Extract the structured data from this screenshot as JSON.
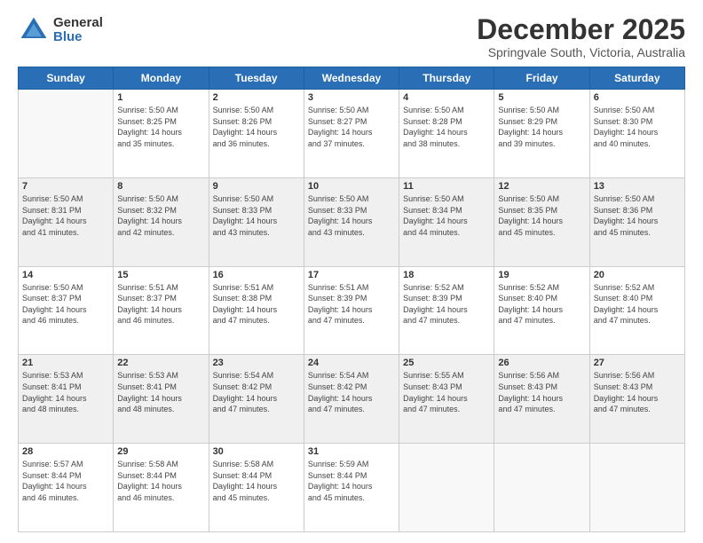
{
  "logo": {
    "general": "General",
    "blue": "Blue"
  },
  "header": {
    "month": "December 2025",
    "location": "Springvale South, Victoria, Australia"
  },
  "days_of_week": [
    "Sunday",
    "Monday",
    "Tuesday",
    "Wednesday",
    "Thursday",
    "Friday",
    "Saturday"
  ],
  "weeks": [
    [
      {
        "day": "",
        "info": ""
      },
      {
        "day": "1",
        "info": "Sunrise: 5:50 AM\nSunset: 8:25 PM\nDaylight: 14 hours\nand 35 minutes."
      },
      {
        "day": "2",
        "info": "Sunrise: 5:50 AM\nSunset: 8:26 PM\nDaylight: 14 hours\nand 36 minutes."
      },
      {
        "day": "3",
        "info": "Sunrise: 5:50 AM\nSunset: 8:27 PM\nDaylight: 14 hours\nand 37 minutes."
      },
      {
        "day": "4",
        "info": "Sunrise: 5:50 AM\nSunset: 8:28 PM\nDaylight: 14 hours\nand 38 minutes."
      },
      {
        "day": "5",
        "info": "Sunrise: 5:50 AM\nSunset: 8:29 PM\nDaylight: 14 hours\nand 39 minutes."
      },
      {
        "day": "6",
        "info": "Sunrise: 5:50 AM\nSunset: 8:30 PM\nDaylight: 14 hours\nand 40 minutes."
      }
    ],
    [
      {
        "day": "7",
        "info": "Sunrise: 5:50 AM\nSunset: 8:31 PM\nDaylight: 14 hours\nand 41 minutes."
      },
      {
        "day": "8",
        "info": "Sunrise: 5:50 AM\nSunset: 8:32 PM\nDaylight: 14 hours\nand 42 minutes."
      },
      {
        "day": "9",
        "info": "Sunrise: 5:50 AM\nSunset: 8:33 PM\nDaylight: 14 hours\nand 43 minutes."
      },
      {
        "day": "10",
        "info": "Sunrise: 5:50 AM\nSunset: 8:33 PM\nDaylight: 14 hours\nand 43 minutes."
      },
      {
        "day": "11",
        "info": "Sunrise: 5:50 AM\nSunset: 8:34 PM\nDaylight: 14 hours\nand 44 minutes."
      },
      {
        "day": "12",
        "info": "Sunrise: 5:50 AM\nSunset: 8:35 PM\nDaylight: 14 hours\nand 45 minutes."
      },
      {
        "day": "13",
        "info": "Sunrise: 5:50 AM\nSunset: 8:36 PM\nDaylight: 14 hours\nand 45 minutes."
      }
    ],
    [
      {
        "day": "14",
        "info": "Sunrise: 5:50 AM\nSunset: 8:37 PM\nDaylight: 14 hours\nand 46 minutes."
      },
      {
        "day": "15",
        "info": "Sunrise: 5:51 AM\nSunset: 8:37 PM\nDaylight: 14 hours\nand 46 minutes."
      },
      {
        "day": "16",
        "info": "Sunrise: 5:51 AM\nSunset: 8:38 PM\nDaylight: 14 hours\nand 47 minutes."
      },
      {
        "day": "17",
        "info": "Sunrise: 5:51 AM\nSunset: 8:39 PM\nDaylight: 14 hours\nand 47 minutes."
      },
      {
        "day": "18",
        "info": "Sunrise: 5:52 AM\nSunset: 8:39 PM\nDaylight: 14 hours\nand 47 minutes."
      },
      {
        "day": "19",
        "info": "Sunrise: 5:52 AM\nSunset: 8:40 PM\nDaylight: 14 hours\nand 47 minutes."
      },
      {
        "day": "20",
        "info": "Sunrise: 5:52 AM\nSunset: 8:40 PM\nDaylight: 14 hours\nand 47 minutes."
      }
    ],
    [
      {
        "day": "21",
        "info": "Sunrise: 5:53 AM\nSunset: 8:41 PM\nDaylight: 14 hours\nand 48 minutes."
      },
      {
        "day": "22",
        "info": "Sunrise: 5:53 AM\nSunset: 8:41 PM\nDaylight: 14 hours\nand 48 minutes."
      },
      {
        "day": "23",
        "info": "Sunrise: 5:54 AM\nSunset: 8:42 PM\nDaylight: 14 hours\nand 47 minutes."
      },
      {
        "day": "24",
        "info": "Sunrise: 5:54 AM\nSunset: 8:42 PM\nDaylight: 14 hours\nand 47 minutes."
      },
      {
        "day": "25",
        "info": "Sunrise: 5:55 AM\nSunset: 8:43 PM\nDaylight: 14 hours\nand 47 minutes."
      },
      {
        "day": "26",
        "info": "Sunrise: 5:56 AM\nSunset: 8:43 PM\nDaylight: 14 hours\nand 47 minutes."
      },
      {
        "day": "27",
        "info": "Sunrise: 5:56 AM\nSunset: 8:43 PM\nDaylight: 14 hours\nand 47 minutes."
      }
    ],
    [
      {
        "day": "28",
        "info": "Sunrise: 5:57 AM\nSunset: 8:44 PM\nDaylight: 14 hours\nand 46 minutes."
      },
      {
        "day": "29",
        "info": "Sunrise: 5:58 AM\nSunset: 8:44 PM\nDaylight: 14 hours\nand 46 minutes."
      },
      {
        "day": "30",
        "info": "Sunrise: 5:58 AM\nSunset: 8:44 PM\nDaylight: 14 hours\nand 45 minutes."
      },
      {
        "day": "31",
        "info": "Sunrise: 5:59 AM\nSunset: 8:44 PM\nDaylight: 14 hours\nand 45 minutes."
      },
      {
        "day": "",
        "info": ""
      },
      {
        "day": "",
        "info": ""
      },
      {
        "day": "",
        "info": ""
      }
    ]
  ]
}
